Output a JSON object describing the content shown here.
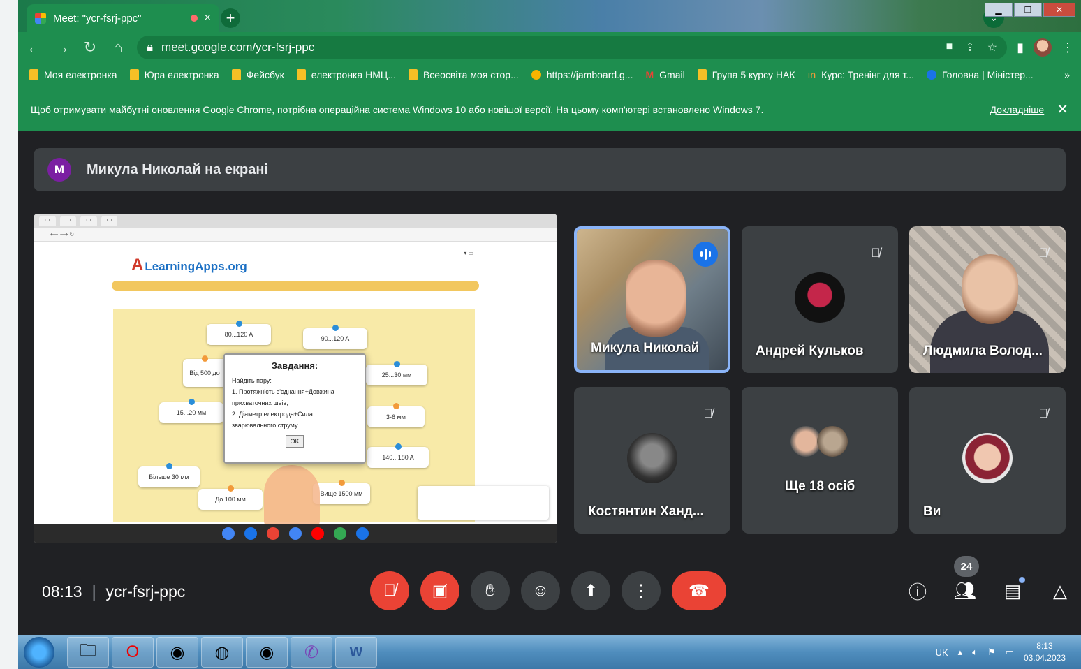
{
  "browser": {
    "tab_title": "Meet: \"ycr-fsrj-ppc\"",
    "tab_close": "×",
    "new_tab": "+",
    "url": "meet.google.com/ycr-fsrj-ppc",
    "bookmarks": [
      {
        "label": "Моя електронка",
        "icon": "folder-icon"
      },
      {
        "label": "Юра електронка",
        "icon": "folder-icon"
      },
      {
        "label": "Фейсбук",
        "icon": "folder-icon"
      },
      {
        "label": "електронка НМЦ...",
        "icon": "folder-icon"
      },
      {
        "label": "Всеосвіта моя стор...",
        "icon": "folder-icon"
      },
      {
        "label": "https://jamboard.g...",
        "icon": "jamboard-icon"
      },
      {
        "label": "Gmail",
        "icon": "gmail-icon"
      },
      {
        "label": "Група 5 курсу НАК",
        "icon": "folder-icon"
      },
      {
        "label": "Курс: Тренінг для т...",
        "icon": "course-icon"
      },
      {
        "label": "Головна | Міністер...",
        "icon": "ministry-icon"
      }
    ],
    "bookmarks_more": "»",
    "infobar_text": "Щоб отримувати майбутні оновлення Google Chrome, потрібна операційна система Windows 10 або новішої версії. На цьому комп'ютері встановлено Windows 7.",
    "infobar_link": "Докладніше",
    "infobar_close": "✕"
  },
  "meet": {
    "presenter_initial": "М",
    "presenter_banner": "Микула Николай на екрані",
    "shared_screen": {
      "logo": "LearningApps.org",
      "dialog_title": "Завдання:",
      "dialog_line1": "Найдіть пару:",
      "dialog_line2": "1. Протяжність з'єднання+Довжина прихваточних швів;",
      "dialog_line3": "2. Діаметр електрода+Сила зварювального струму.",
      "dialog_ok": "OK",
      "cards": [
        "80...120 A",
        "90...120 A",
        "Від 500 до",
        "25...30 мм",
        "15...20 мм",
        "3-6 мм",
        "140...180 A",
        "Більше 30 мм",
        "До 100 мм",
        "Вище 1500 мм"
      ]
    },
    "participants": [
      {
        "name": "Микула Николай",
        "muted": false,
        "speaking": true
      },
      {
        "name": "Андрей Кульков",
        "muted": true
      },
      {
        "name": "Людмила Волод...",
        "muted": true
      },
      {
        "name": "Костянтин Ханд...",
        "muted": true
      },
      {
        "name": "Ще 18 осіб",
        "muted": false
      },
      {
        "name": "Ви",
        "muted": true
      }
    ],
    "time": "08:13",
    "meeting_code": "ycr-fsrj-ppc",
    "participant_count": "24"
  },
  "taskbar": {
    "lang": "UK",
    "time": "8:13",
    "date": "03.04.2023"
  },
  "colors": {
    "chrome_green": "#1e8e4f",
    "meet_bg": "#202124",
    "tile_bg": "#3c4043",
    "danger": "#ea4335",
    "accent": "#8ab4f8"
  }
}
